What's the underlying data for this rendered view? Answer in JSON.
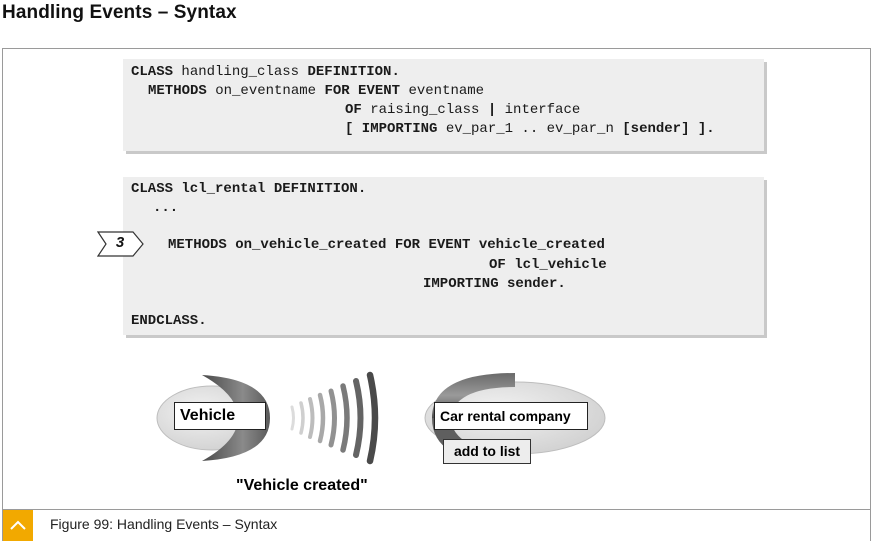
{
  "page": {
    "title": "Handling Events – Syntax"
  },
  "syntax_box": {
    "line1": {
      "kw1": "CLASS",
      "t1": " handling_class ",
      "kw2": "DEFINITION",
      "t2": "."
    },
    "line2": {
      "kw1": "METHODS",
      "t1": " on_eventname ",
      "kw2": "FOR EVENT",
      "t2": " eventname"
    },
    "line3": {
      "kw1": "OF",
      "t1": " raising_class ",
      "kw2": "|",
      "t2": " interface"
    },
    "line4": {
      "kw1": "[ IMPORTING",
      "t1": " ev_par_1 .. ev_par_n ",
      "kw2": "[sender] ]",
      "t2": "."
    }
  },
  "example_box": {
    "line1": "CLASS lcl_rental DEFINITION.",
    "line2": "...",
    "line3": "METHODS on_vehicle_created FOR EVENT vehicle_created",
    "line4": "OF lcl_vehicle",
    "line5": "IMPORTING sender.",
    "line6": "ENDCLASS."
  },
  "step_marker": "3",
  "diagram": {
    "sender_label": "Vehicle",
    "receiver_label": "Car rental company",
    "action_label": "add to list",
    "event_label": "\"Vehicle created\""
  },
  "caption": {
    "text": "Figure 99: Handling Events – Syntax"
  },
  "colors": {
    "accent": "#f2a900",
    "code_background": "#eeeeee"
  }
}
